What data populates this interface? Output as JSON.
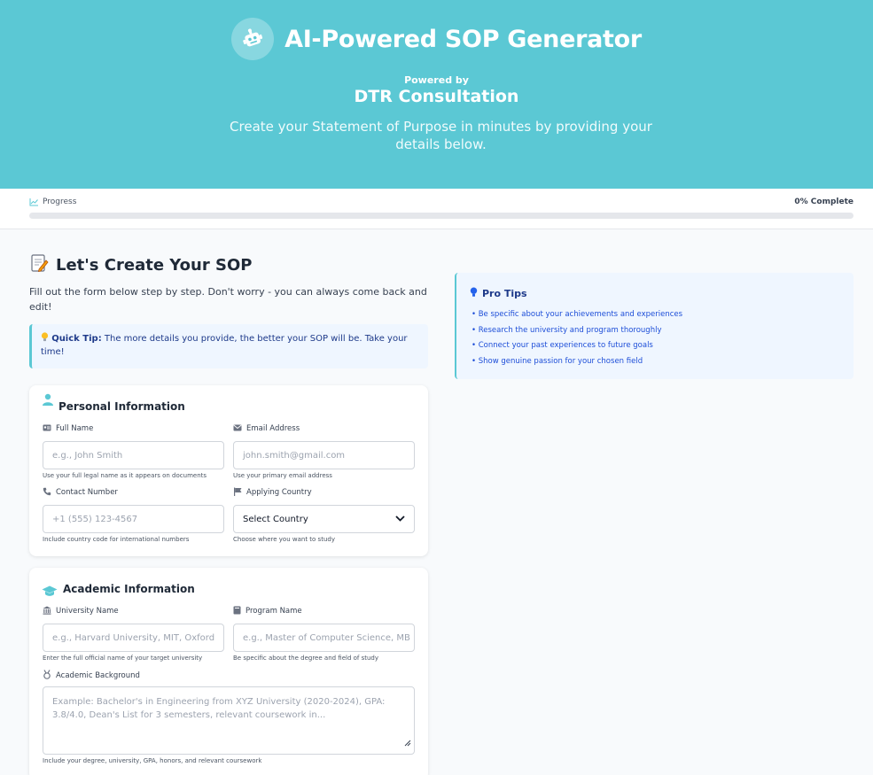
{
  "header": {
    "title": "AI-Powered SOP Generator",
    "powered_by": "Powered by",
    "brand": "DTR Consultation",
    "tagline": "Create your Statement of Purpose in minutes by providing your details below.",
    "logo_icon": "robot-icon",
    "background_color": "#5bc8d4"
  },
  "progress": {
    "label": "Progress",
    "status": "0% Complete",
    "value_percent": 0,
    "icon": "chart-line-icon"
  },
  "intro": {
    "title": "Let's Create Your SOP",
    "title_icon": "memo-icon",
    "description": "Fill out the form below step by step. Don't worry - you can always come back and edit!"
  },
  "quick_tip": {
    "label": "Quick Tip:",
    "text": " The more details you provide, the better your SOP will be. Take your time!",
    "icon": "lightbulb-icon"
  },
  "personal": {
    "title": "Personal Information",
    "icon": "user-icon",
    "fields": [
      {
        "label": "Full Name",
        "icon": "id-card-icon",
        "placeholder": "e.g., John Smith",
        "hint": "Use your full legal name as it appears on documents"
      },
      {
        "label": "Email Address",
        "icon": "envelope-icon",
        "placeholder": "john.smith@gmail.com",
        "hint": "Use your primary email address"
      },
      {
        "label": "Contact Number",
        "icon": "phone-icon",
        "placeholder": "+1 (555) 123-4567",
        "hint": "Include country code for international numbers"
      },
      {
        "label": "Applying Country",
        "icon": "flag-icon",
        "value": "Select Country",
        "hint": "Choose where you want to study"
      }
    ]
  },
  "academic": {
    "title": "Academic Information",
    "icon": "graduation-cap-icon",
    "fields": [
      {
        "label": "University Name",
        "icon": "university-icon",
        "placeholder": "e.g., Harvard University, MIT, Oxford",
        "hint": "Enter the full official name of your target university"
      },
      {
        "label": "Program Name",
        "icon": "book-icon",
        "placeholder": "e.g., Master of Computer Science, MB",
        "hint": "Be specific about the degree and field of study"
      },
      {
        "label": "Academic Background",
        "icon": "medal-icon",
        "placeholder": "Example: Bachelor's in Engineering from XYZ University (2020-2024), GPA: 3.8/4.0, Dean's List for 3 semesters, relevant coursework in...",
        "hint": "Include your degree, university, GPA, honors, and relevant coursework"
      }
    ]
  },
  "pro_tips": {
    "title": "Pro Tips",
    "icon": "lightbulb-icon",
    "items": [
      "• Be specific about your achievements and experiences",
      "• Research the university and program thoroughly",
      "• Connect your past experiences to future goals",
      "• Show genuine passion for your chosen field"
    ]
  }
}
